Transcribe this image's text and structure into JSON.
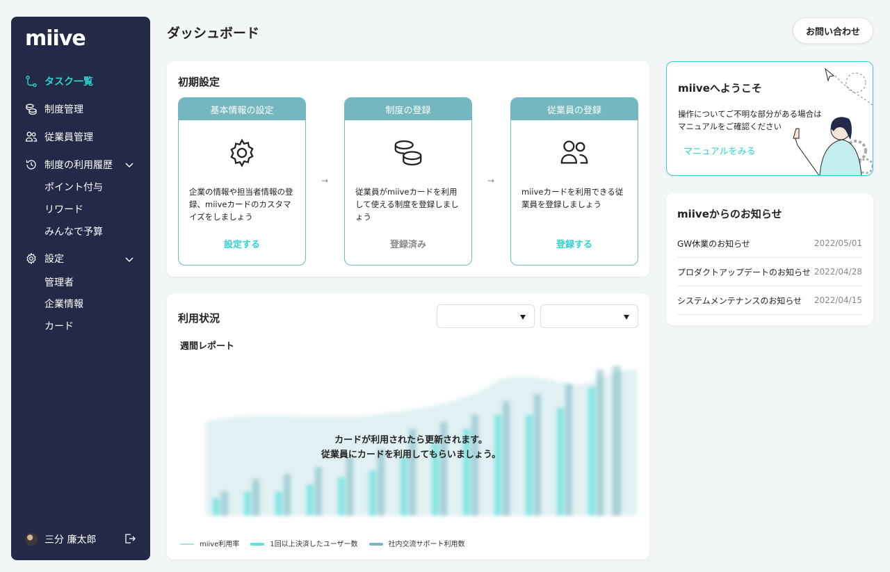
{
  "brand": "miive",
  "sidebar": {
    "items": [
      {
        "label": "タスク一覧",
        "icon": "task-flow-icon",
        "active": true
      },
      {
        "label": "制度管理",
        "icon": "coins-icon"
      },
      {
        "label": "従業員管理",
        "icon": "users-icon"
      },
      {
        "label": "制度の利用履歴",
        "icon": "history-icon",
        "children": [
          "ポイント付与",
          "リワード",
          "みんなで予算"
        ]
      },
      {
        "label": "設定",
        "icon": "gear-icon",
        "children": [
          "管理者",
          "企業情報",
          "カード"
        ]
      }
    ],
    "user": "三分 廉太郎"
  },
  "header": {
    "title": "ダッシュボード",
    "contact_label": "お問い合わせ"
  },
  "setup": {
    "title": "初期設定",
    "steps": [
      {
        "head": "基本情報の設定",
        "icon": "gear-icon",
        "desc": "企業の情報や担当者情報の登録、miiveカードのカスタマイズをしましょう",
        "action": "設定する",
        "done": false
      },
      {
        "head": "制度の登録",
        "icon": "coins-icon",
        "desc": "従業員がmiiveカードを利用して使える制度を登録しましょう",
        "action": "登録済み",
        "done": true
      },
      {
        "head": "従業員の登録",
        "icon": "users-icon",
        "desc": "miiveカードを利用できる従業員を登録しましょう",
        "action": "登録する",
        "done": false
      }
    ],
    "arrow": "→"
  },
  "usage": {
    "title": "利用状況",
    "select1": "",
    "select2": "",
    "subtitle": "週間レポート",
    "message_line1": "カードが利用されたら更新されます。",
    "message_line2": "従業員にカードを利用してもらいましょう。",
    "legend": [
      {
        "label": "miive利用率",
        "color": "#b7d9e2"
      },
      {
        "label": "1回以上決済したユーザー数",
        "color": "#5fe0dc"
      },
      {
        "label": "社内交流サポート利用数",
        "color": "#74b7c0"
      }
    ]
  },
  "welcome": {
    "title": "miiveへようこそ",
    "text_line1": "操作についてご不明な部分がある場合は",
    "text_line2": "マニュアルをご確認ください",
    "link": "マニュアルをみる"
  },
  "news": {
    "title": "miiveからのお知らせ",
    "items": [
      {
        "title": "GW休業のお知らせ",
        "date": "2022/05/01"
      },
      {
        "title": "プロダクトアップデートのお知らせ",
        "date": "2022/04/28"
      },
      {
        "title": "システムメンテナンスのお知らせ",
        "date": "2022/04/15"
      }
    ]
  },
  "colors": {
    "accent": "#2ed2d0",
    "sidebar": "#232a48",
    "step": "#74b7c0"
  }
}
